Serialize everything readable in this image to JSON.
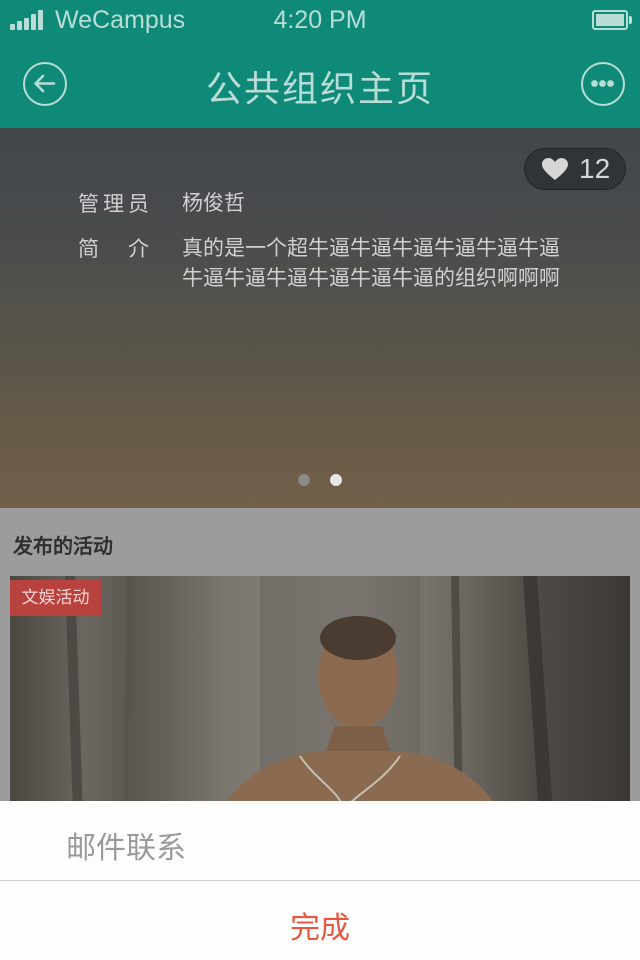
{
  "status_bar": {
    "carrier": "WeCampus",
    "time": "4:20 PM"
  },
  "nav": {
    "title": "公共组织主页",
    "back_icon": "back-circle-icon",
    "more_icon": "more-dots-icon"
  },
  "header": {
    "likes": {
      "icon": "heart-icon",
      "count": "12"
    },
    "admin_label": "管理员",
    "admin_value": "杨俊哲",
    "intro_label": "简　介",
    "intro_value": "真的是一个超牛逼牛逼牛逼牛逼牛逼牛逼牛逼牛逼牛逼牛逼牛逼牛逼的组织啊啊啊",
    "pager": {
      "count": 2,
      "active_index": 1
    }
  },
  "activities": {
    "title": "发布的活动",
    "items": [
      {
        "tag": "文娱活动"
      }
    ]
  },
  "action_sheet": {
    "items": [
      {
        "label": "邮件联系"
      }
    ],
    "confirm_label": "完成"
  },
  "colors": {
    "brand": "#0f8a78",
    "nav_text": "#b9ddd6",
    "tag": "#b8423d",
    "confirm": "#e8583e"
  }
}
